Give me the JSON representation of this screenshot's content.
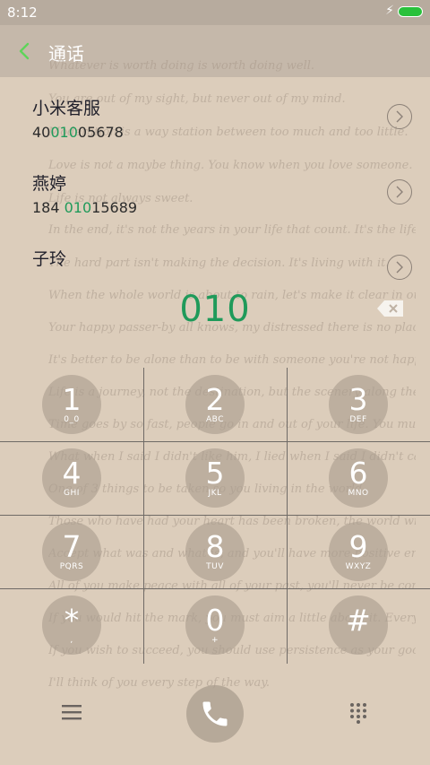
{
  "status": {
    "time": "8:12"
  },
  "header": {
    "title": "通话"
  },
  "background_lines": [
    "Whatever is worth doing is worth doing well.",
    "You are out of my sight, but never out of my mind.",
    "Moderation is a way station between too much and too little.",
    "Love is not a maybe thing. You know when you love someone.",
    "Life is not always sweet.",
    "In the end, it's not the years in your life that count. It's the life in your years.",
    "The hard part isn't making the decision. It's living with it.",
    "When the whole world is about to rain, let's make it clear in our heart together.",
    "Your happy passer-by all knows, my distressed there is no place hidden.",
    "It's better to be alone than to be with someone you're not happy to be with.",
    "Life is a journey, not the destination, but the scenery along the should be and the mood at the view.",
    "Time goes by so fast, people go in and out of your life. You must never miss the opportunity to tell these people how much they mean to you.",
    "What when I said I didn't like him, I lied when I said I didn't care.",
    "One of 3 things to be taken so you living in the world.",
    "Those who have had your heart has been broken, the world will be better.",
    "Accept what was and what is, and you'll have more positive energy to pursue what will be.",
    "All of you make peace with all of your past, you'll never be content with your present.",
    "If you would hit the mark, you must aim a little above it. Every arrow that flies feels the attraction of earth.",
    "If you wish to succeed, you should use persistence as your good friend.",
    "I'll think of you every step of the way."
  ],
  "contacts": [
    {
      "name": "小米客服",
      "number_pre": "40",
      "number_hl": "010",
      "number_post": "05678"
    },
    {
      "name": "燕婷",
      "number_pre": "184 ",
      "number_hl": "010",
      "number_post": "15689"
    },
    {
      "name": "子玲",
      "number_pre": "",
      "number_hl": "",
      "number_post": ""
    }
  ],
  "dialed_number": "010",
  "keys": [
    {
      "digit": "1",
      "letters": "0_0"
    },
    {
      "digit": "2",
      "letters": "ABC"
    },
    {
      "digit": "3",
      "letters": "DEF"
    },
    {
      "digit": "4",
      "letters": "GHI"
    },
    {
      "digit": "5",
      "letters": "JKL"
    },
    {
      "digit": "6",
      "letters": "MNO"
    },
    {
      "digit": "7",
      "letters": "PQRS"
    },
    {
      "digit": "8",
      "letters": "TUV"
    },
    {
      "digit": "9",
      "letters": "WXYZ"
    },
    {
      "digit": "*",
      "letters": ","
    },
    {
      "digit": "0",
      "letters": "+"
    },
    {
      "digit": "#",
      "letters": ""
    }
  ],
  "colors": {
    "accent": "#1f9a5a",
    "back": "#5fd45a",
    "battery": "#29c13b"
  },
  "icons": {
    "back": "chevron-left",
    "backspace": "backspace",
    "menu": "hamburger",
    "call": "phone",
    "keypad": "dial-grid"
  }
}
